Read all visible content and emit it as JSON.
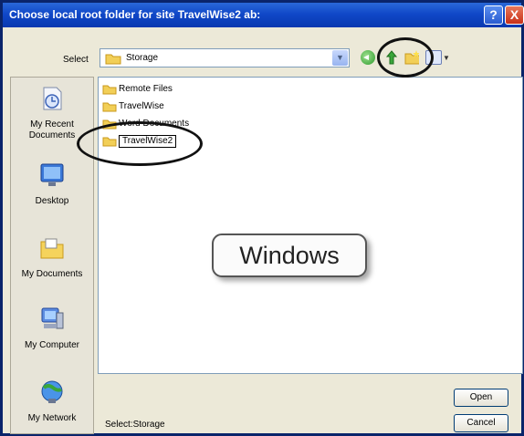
{
  "window": {
    "title": "Choose local root folder for site TravelWise2 ab:",
    "help_label": "?",
    "close_label": "X"
  },
  "select": {
    "label": "Select",
    "value": "Storage"
  },
  "places": [
    {
      "label": "My Recent Documents",
      "icon": "recent-documents-icon"
    },
    {
      "label": "Desktop",
      "icon": "desktop-icon"
    },
    {
      "label": "My Documents",
      "icon": "my-documents-icon"
    },
    {
      "label": "My Computer",
      "icon": "my-computer-icon"
    },
    {
      "label": "My Network",
      "icon": "my-network-icon"
    }
  ],
  "files": [
    {
      "name": "Remote Files"
    },
    {
      "name": "TravelWise"
    },
    {
      "name": "Word Documents"
    },
    {
      "name": "TravelWise2"
    }
  ],
  "callout": "Windows",
  "footer": {
    "selected_text": "Select:Storage",
    "open_label": "Open",
    "cancel_label": "Cancel"
  },
  "colors": {
    "titlebar": "#1048c8",
    "dialog_bg": "#ece9d8",
    "folder": "#f2cf57"
  }
}
